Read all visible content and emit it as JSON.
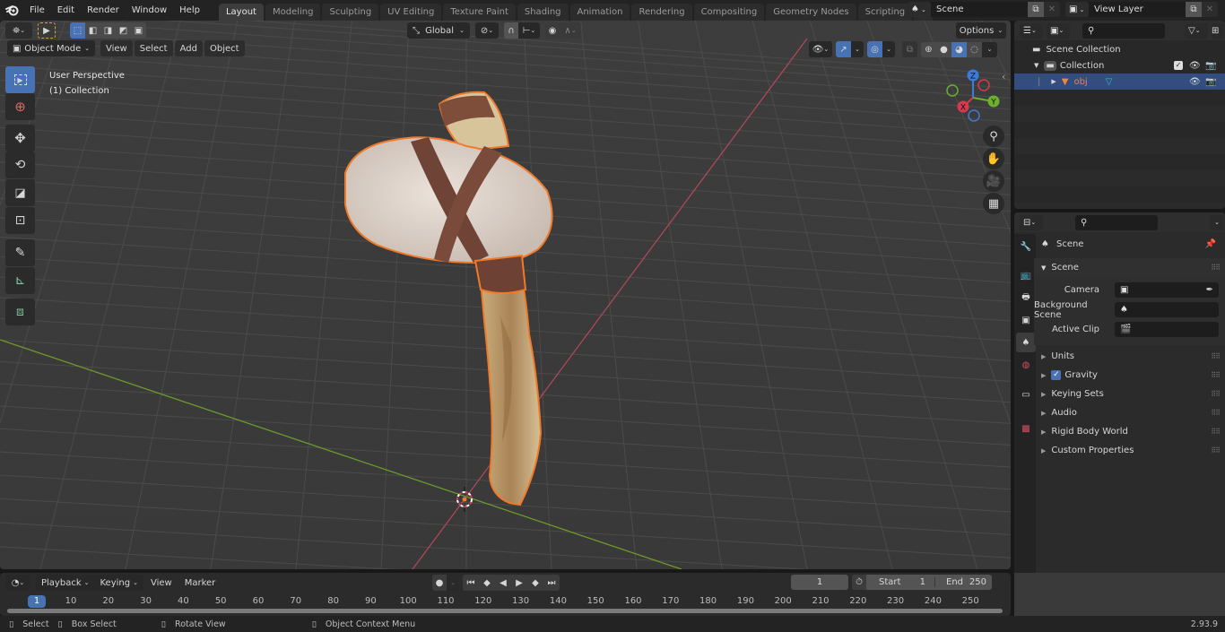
{
  "app": {
    "version": "2.93.9"
  },
  "menu": [
    "File",
    "Edit",
    "Render",
    "Window",
    "Help"
  ],
  "workspaces": [
    {
      "label": "Layout",
      "active": true
    },
    {
      "label": "Modeling",
      "active": false
    },
    {
      "label": "Sculpting",
      "active": false
    },
    {
      "label": "UV Editing",
      "active": false
    },
    {
      "label": "Texture Paint",
      "active": false
    },
    {
      "label": "Shading",
      "active": false
    },
    {
      "label": "Animation",
      "active": false
    },
    {
      "label": "Rendering",
      "active": false
    },
    {
      "label": "Compositing",
      "active": false
    },
    {
      "label": "Geometry Nodes",
      "active": false
    },
    {
      "label": "Scripting",
      "active": false
    }
  ],
  "add_workspace_label": "+",
  "scene_selector": {
    "value": "Scene"
  },
  "view_layer_selector": {
    "value": "View Layer"
  },
  "viewport": {
    "mode": "Object Mode",
    "menus": [
      "View",
      "Select",
      "Add",
      "Object"
    ],
    "transform_orientation": "Global",
    "options_label": "Options",
    "overlay_text": {
      "line1": "User Perspective",
      "line2": "(1) Collection"
    },
    "gizmo_axes": {
      "z": "Z",
      "y": "Y",
      "x": "X"
    },
    "colors": {
      "x_axis": "#c8435a",
      "y_axis": "#6c9a2a",
      "selection_outline": "#f07a2c",
      "active_tool": "#4772b3"
    }
  },
  "tools": [
    "select-box",
    "cursor",
    "move",
    "rotate",
    "scale",
    "transform",
    "annotate",
    "measure",
    "add-cube"
  ],
  "outliner": {
    "search_placeholder": "",
    "items": [
      {
        "label": "Scene Collection",
        "level": 0
      },
      {
        "label": "Collection",
        "level": 1,
        "checked": true
      },
      {
        "label": "obj",
        "level": 2,
        "selected": true
      }
    ]
  },
  "properties": {
    "search_placeholder": "",
    "context_title": "Scene",
    "panel_title": "Scene",
    "fields": [
      {
        "label": "Camera",
        "value": ""
      },
      {
        "label": "Background Scene",
        "value": ""
      },
      {
        "label": "Active Clip",
        "value": ""
      }
    ],
    "subpanels": [
      {
        "label": "Units",
        "checkbox": false
      },
      {
        "label": "Gravity",
        "checkbox": true,
        "checked": true
      },
      {
        "label": "Keying Sets",
        "checkbox": false
      },
      {
        "label": "Audio",
        "checkbox": false
      },
      {
        "label": "Rigid Body World",
        "checkbox": false
      },
      {
        "label": "Custom Properties",
        "checkbox": false
      }
    ]
  },
  "timeline": {
    "menus": {
      "playback": "Playback",
      "keying": "Keying",
      "view": "View",
      "marker": "Marker"
    },
    "current_frame": "1",
    "start_label": "Start",
    "start": "1",
    "end_label": "End",
    "end": "250",
    "ruler": [
      "10",
      "20",
      "30",
      "40",
      "50",
      "60",
      "70",
      "80",
      "90",
      "100",
      "110",
      "120",
      "130",
      "140",
      "150",
      "160",
      "170",
      "180",
      "190",
      "200",
      "210",
      "220",
      "230",
      "240",
      "250"
    ],
    "playhead": "1"
  },
  "status_bar": {
    "select": "Select",
    "box_select": "Box Select",
    "rotate_view": "Rotate View",
    "context_menu": "Object Context Menu"
  }
}
